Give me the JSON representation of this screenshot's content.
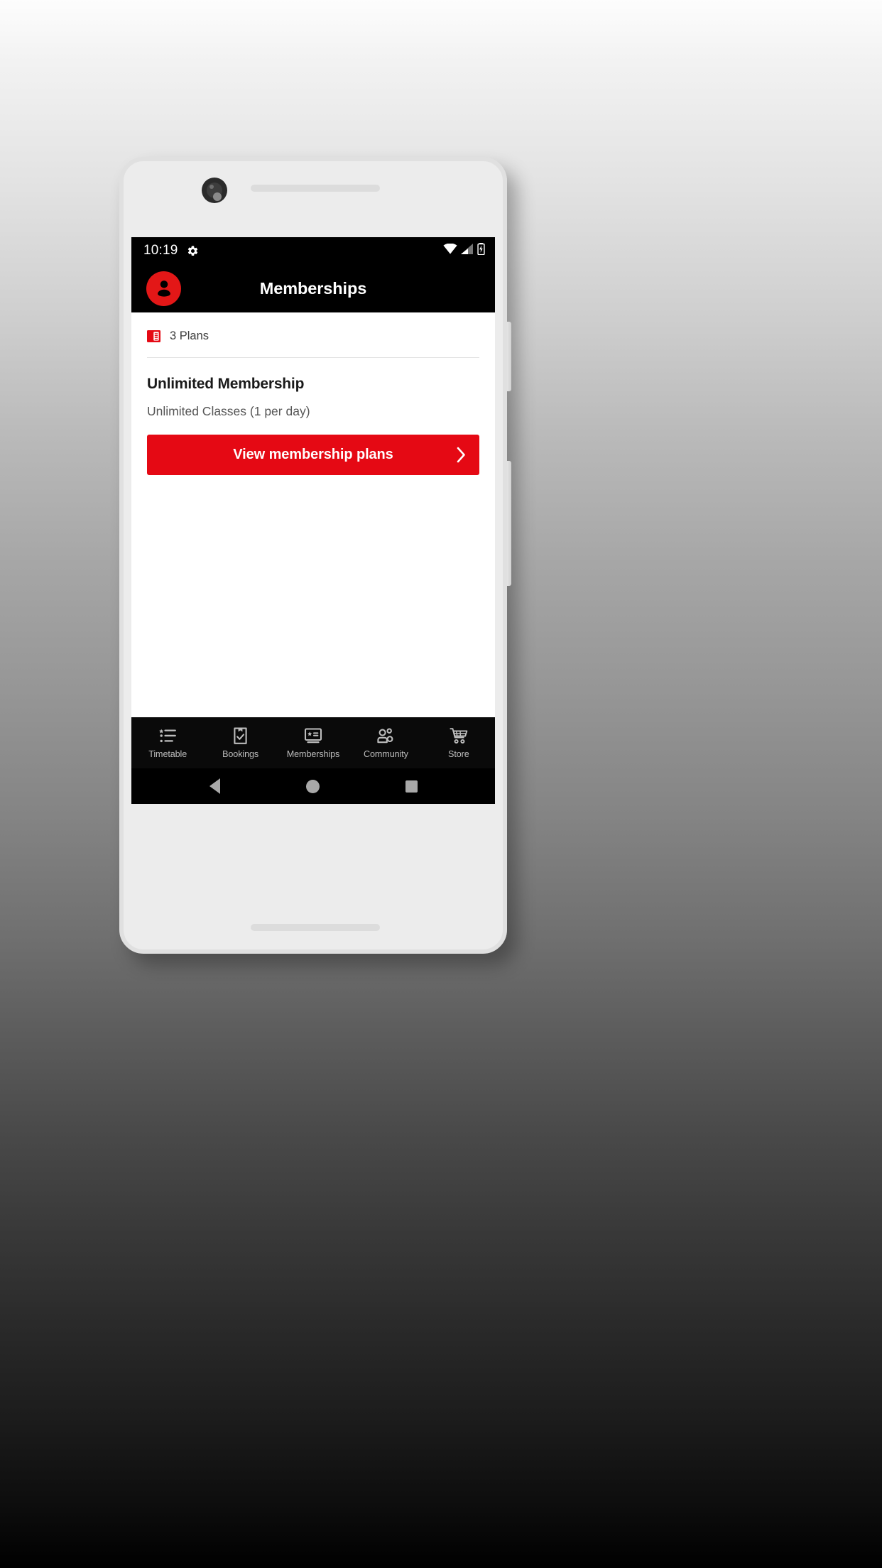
{
  "device": {
    "camera_icon": "camera-lens",
    "earpiece_icon": "earpiece-speaker",
    "bottom_speaker_icon": "bottom-speaker-grille",
    "volume_button_label": "Volume",
    "power_button_label": "Power"
  },
  "status_bar": {
    "time": "10:19",
    "gear_icon": "gear-icon",
    "wifi_icon": "wifi-icon",
    "signal_icon": "cellular-signal-icon",
    "battery_icon": "battery-charging-icon"
  },
  "app_bar": {
    "avatar_icon": "account-avatar-icon",
    "title": "Memberships",
    "background_color": "#000000",
    "accent_color": "#e50914"
  },
  "main": {
    "plans_icon": "membership-card-icon",
    "plans_count_label": "3 Plans",
    "plan": {
      "title": "Unlimited Membership",
      "subtitle": "Unlimited Classes (1 per day)"
    },
    "cta": {
      "label": "View membership plans",
      "chevron_icon": "chevron-right-icon",
      "background_color": "#e50914"
    }
  },
  "tab_bar": {
    "items": [
      {
        "label": "Timetable",
        "icon": "list-timetable-icon"
      },
      {
        "label": "Bookings",
        "icon": "clipboard-check-icon"
      },
      {
        "label": "Memberships",
        "icon": "membership-card-icon"
      },
      {
        "label": "Community",
        "icon": "people-group-icon"
      },
      {
        "label": "Store",
        "icon": "shopping-cart-icon"
      }
    ]
  },
  "android_nav": {
    "back_label": "Back",
    "home_label": "Home",
    "recents_label": "Recents",
    "back_icon": "triangle-back-icon",
    "home_icon": "circle-home-icon",
    "recents_icon": "square-recents-icon"
  }
}
